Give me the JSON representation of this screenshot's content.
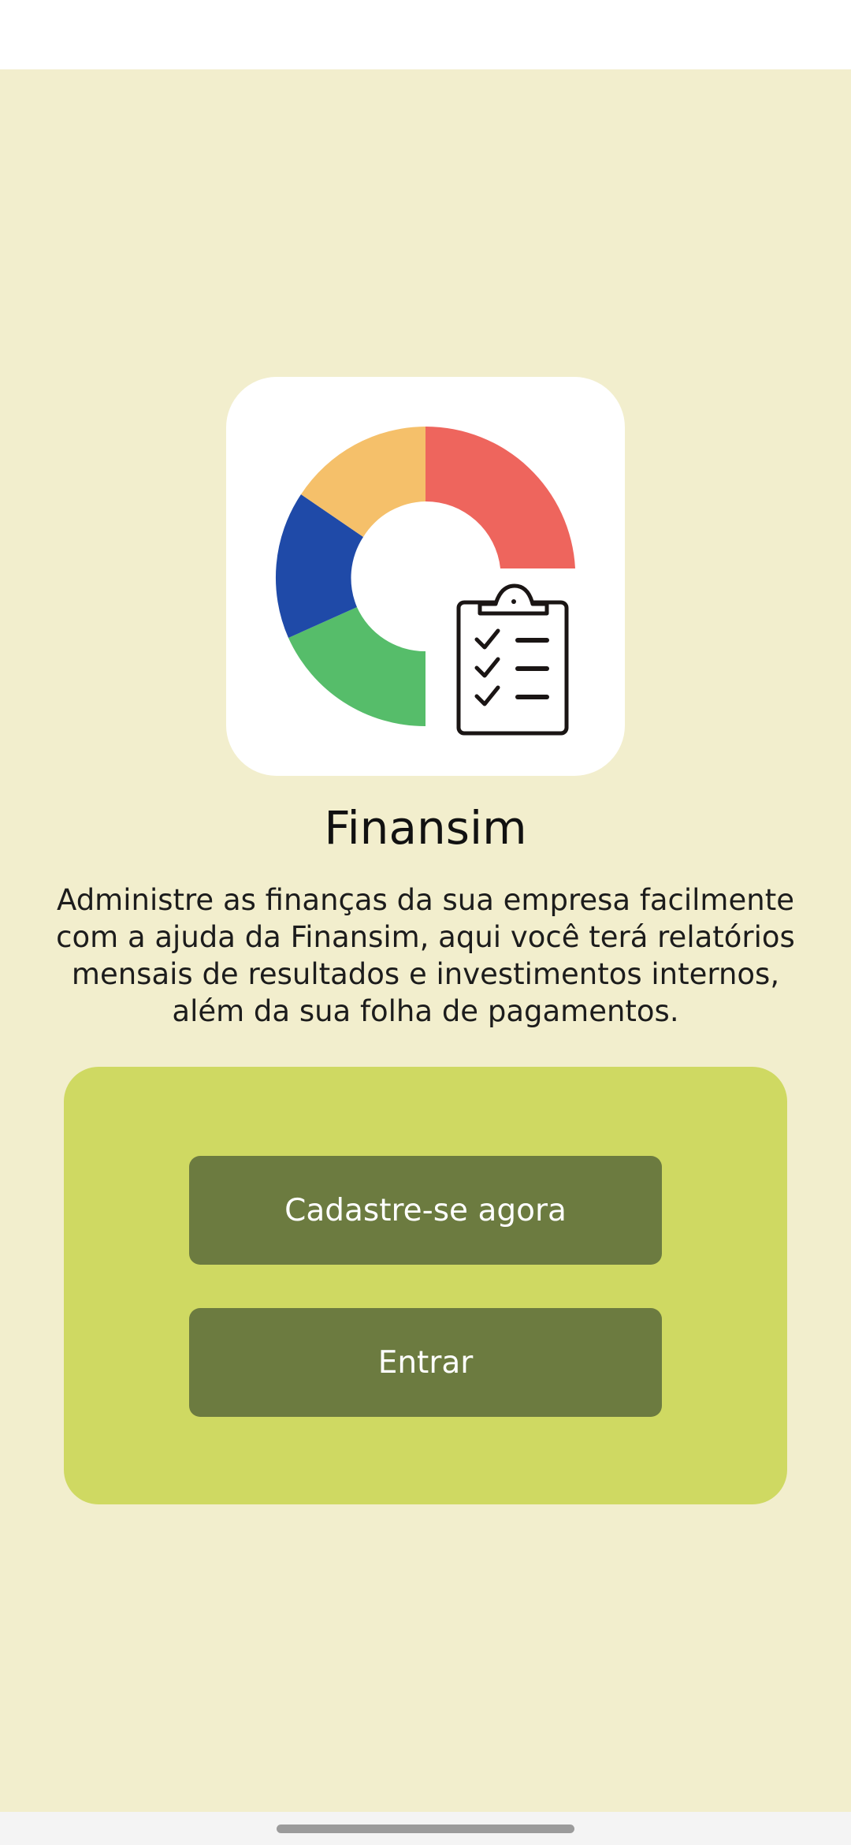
{
  "app": {
    "title": "Finansim",
    "description": "Administre as finanças da sua empresa facilmente com a ajuda da Finansim, aqui você terá relatórios mensais de resultados e investimentos internos, além da sua folha de pagamentos."
  },
  "logo": {
    "icon": "donut-chart-clipboard-icon",
    "segment_colors": [
      "#ee655d",
      "#56bd6a",
      "#1f4aa8",
      "#f5c06a"
    ]
  },
  "actions": {
    "signup_label": "Cadastre-se agora",
    "login_label": "Entrar"
  },
  "colors": {
    "background": "#f2eecd",
    "panel": "#cfd962",
    "button": "#6c7b40",
    "button_text": "#ffffff"
  }
}
